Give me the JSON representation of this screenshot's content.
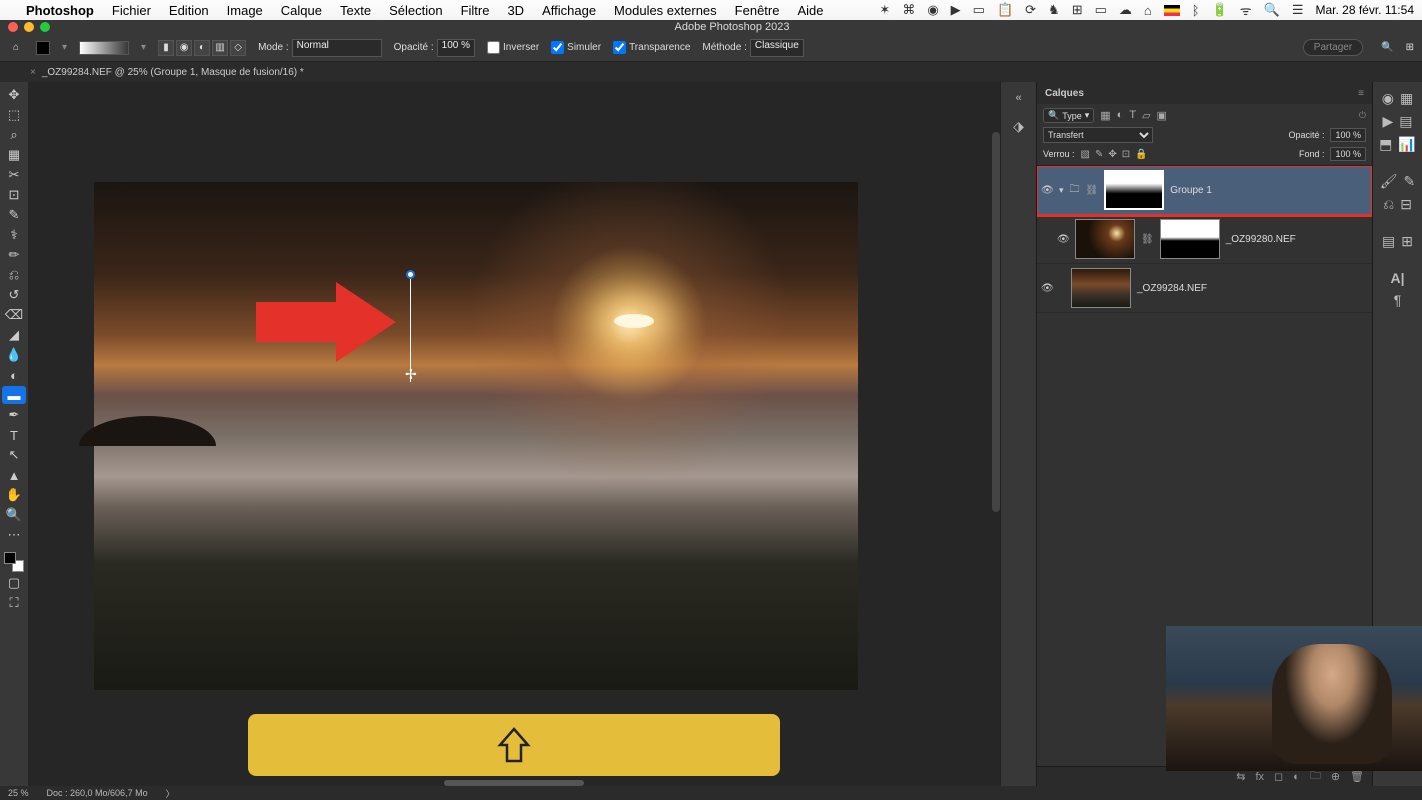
{
  "mac_menu": {
    "app": "Photoshop",
    "items": [
      "Fichier",
      "Edition",
      "Image",
      "Calque",
      "Texte",
      "Sélection",
      "Filtre",
      "3D",
      "Affichage",
      "Modules externes",
      "Fenêtre",
      "Aide"
    ],
    "clock": "Mar. 28 févr.  11:54"
  },
  "window": {
    "title": "Adobe Photoshop 2023"
  },
  "options": {
    "mode_label": "Mode :",
    "mode_value": "Normal",
    "opacity_label": "Opacité :",
    "opacity_value": "100 %",
    "invert_label": "Inverser",
    "simulate_label": "Simuler",
    "transparency_label": "Transparence",
    "method_label": "Méthode :",
    "method_value": "Classique",
    "share_label": "Partager"
  },
  "doc_tab": {
    "name": "_OZ99284.NEF @ 25% (Groupe 1, Masque de fusion/16) *"
  },
  "layers_panel": {
    "tab": "Calques",
    "type_label": "Type",
    "blend_mode": "Transfert",
    "opacity_label": "Opacité :",
    "opacity_value": "100 %",
    "lock_label": "Verrou :",
    "fill_label": "Fond :",
    "fill_value": "100 %",
    "layers": [
      {
        "name": "Groupe 1",
        "kind": "group"
      },
      {
        "name": "_OZ99280.NEF",
        "kind": "smart"
      },
      {
        "name": "_OZ99284.NEF",
        "kind": "smart"
      }
    ]
  },
  "status": {
    "zoom": "25 %",
    "doc_info": "Doc : 260,0 Mo/606,7 Mo"
  }
}
